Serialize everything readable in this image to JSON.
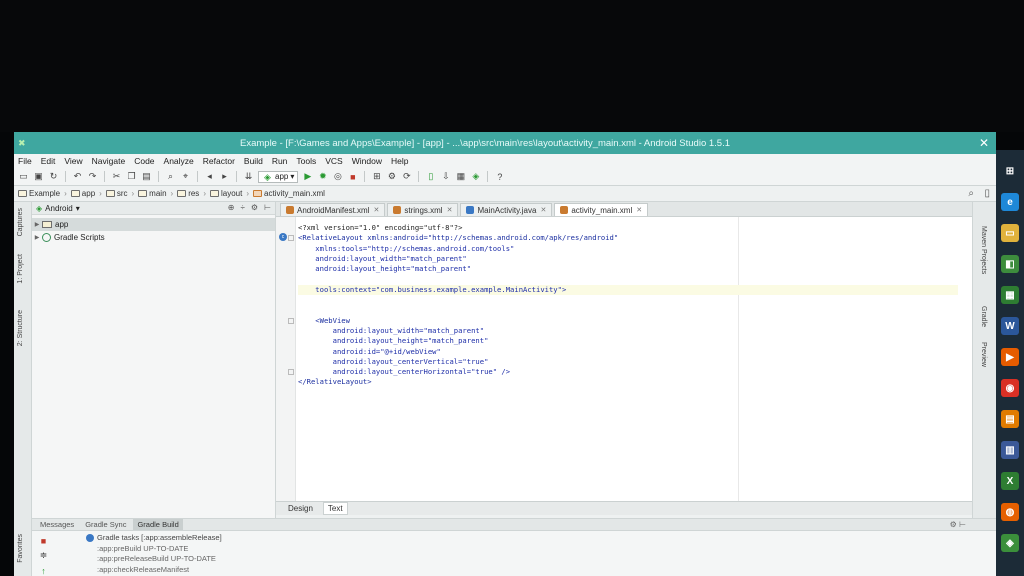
{
  "window": {
    "title": "Example - [F:\\Games and Apps\\Example] - [app] - ...\\app\\src\\main\\res\\layout\\activity_main.xml - Android Studio 1.5.1",
    "close_glyph": "✕"
  },
  "menu": {
    "items": [
      "File",
      "Edit",
      "View",
      "Navigate",
      "Code",
      "Analyze",
      "Refactor",
      "Build",
      "Run",
      "Tools",
      "VCS",
      "Window",
      "Help"
    ]
  },
  "toolbar": {
    "run_config": "app"
  },
  "breadcrumbs": [
    "Example",
    "app",
    "src",
    "main",
    "res",
    "layout",
    "activity_main.xml"
  ],
  "project_panel": {
    "view_select": "Android",
    "tree": [
      {
        "label": "app",
        "type": "folder",
        "selected": true
      },
      {
        "label": "Gradle Scripts",
        "type": "gradle",
        "selected": false
      }
    ]
  },
  "left_strip": [
    "Captures",
    "1: Project",
    "2: Structure",
    "Favorites"
  ],
  "right_strip": [
    "Maven Projects",
    "Gradle",
    "Preview"
  ],
  "editor_tabs": [
    {
      "label": "AndroidManifest.xml",
      "icon_color": "#c97a2f",
      "active": false
    },
    {
      "label": "strings.xml",
      "icon_color": "#c97a2f",
      "active": false
    },
    {
      "label": "MainActivity.java",
      "icon_color": "#3a78c4",
      "active": false
    },
    {
      "label": "activity_main.xml",
      "icon_color": "#c97a2f",
      "active": true
    }
  ],
  "editor": {
    "lines": [
      "<?xml version=\"1.0\" encoding=\"utf-8\"?>",
      "<RelativeLayout xmlns:android=\"http://schemas.android.com/apk/res/android\"",
      "    xmlns:tools=\"http://schemas.android.com/tools\"",
      "    android:layout_width=\"match_parent\"",
      "    android:layout_height=\"match_parent\"",
      "",
      "    tools:context=\"com.business.example.example.MainActivity\">",
      "",
      "",
      "    <WebView",
      "        android:layout_width=\"match_parent\"",
      "        android:layout_height=\"match_parent\"",
      "        android:id=\"@+id/webView\"",
      "        android:layout_centerVertical=\"true\"",
      "        android:layout_centerHorizontal=\"true\" />",
      "</RelativeLayout>"
    ],
    "bottom_tabs": [
      "Design",
      "Text"
    ],
    "active_bottom_tab": "Text"
  },
  "messages": {
    "tabs": [
      "Messages",
      "Gradle Sync",
      "Gradle Build"
    ],
    "active_tab": "Gradle Build",
    "lines": [
      "Gradle tasks [:app:assembleRelease]",
      ":app:preBuild UP-TO-DATE",
      ":app:preReleaseBuild UP-TO-DATE",
      ":app:checkReleaseManifest"
    ]
  },
  "taskbar": {
    "icons": [
      {
        "name": "windows-start-icon",
        "color": "#1c2b37",
        "glyph": "⊞"
      },
      {
        "name": "internet-explorer-icon",
        "color": "#1e88d8",
        "glyph": "e"
      },
      {
        "name": "file-explorer-icon",
        "color": "#e0b23c",
        "glyph": "▭"
      },
      {
        "name": "store-icon",
        "color": "#3d8c3d",
        "glyph": "◧"
      },
      {
        "name": "app-tiles-icon",
        "color": "#2e7d32",
        "glyph": "▦"
      },
      {
        "name": "word-icon",
        "color": "#2b579a",
        "glyph": "W"
      },
      {
        "name": "media-player-icon",
        "color": "#e65c00",
        "glyph": "▶"
      },
      {
        "name": "chrome-icon",
        "color": "#d93025",
        "glyph": "◉"
      },
      {
        "name": "sticky-notes-icon",
        "color": "#e07b00",
        "glyph": "▤"
      },
      {
        "name": "document-icon",
        "color": "#3b5998",
        "glyph": "▥"
      },
      {
        "name": "excel-icon",
        "color": "#2e7d32",
        "glyph": "X"
      },
      {
        "name": "firefox-icon",
        "color": "#e66000",
        "glyph": "◍"
      },
      {
        "name": "android-studio-icon",
        "color": "#3b8f3b",
        "glyph": "◈"
      }
    ]
  }
}
